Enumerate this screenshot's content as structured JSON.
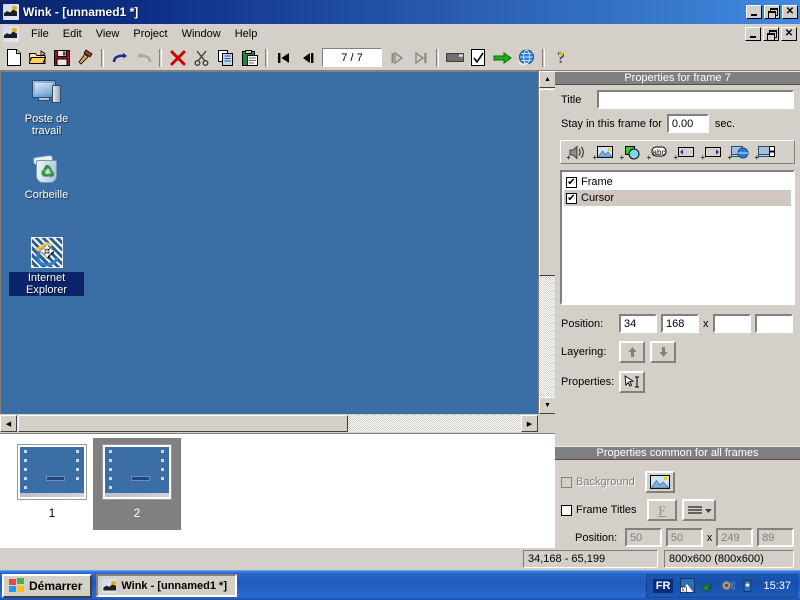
{
  "window": {
    "title": "Wink - [unnamed1 *]",
    "app_icon": "wink-bird-icon",
    "controls": {
      "minimize": "minimize-icon",
      "restore": "restore-icon",
      "close": "close-icon"
    }
  },
  "menu": {
    "items": [
      {
        "label": "File"
      },
      {
        "label": "Edit"
      },
      {
        "label": "View"
      },
      {
        "label": "Project"
      },
      {
        "label": "Window"
      },
      {
        "label": "Help"
      }
    ]
  },
  "toolbar": {
    "buttons": [
      {
        "name": "new-file-icon",
        "title": "New"
      },
      {
        "name": "open-folder-icon",
        "title": "Open"
      },
      {
        "name": "save-disk-icon",
        "title": "Save"
      },
      {
        "name": "hammer-build-icon",
        "title": "Render"
      },
      {
        "name": "undo-arrow-icon",
        "title": "Undo"
      },
      {
        "name": "redo-arrow-icon",
        "title": "Redo"
      },
      {
        "name": "delete-x-icon",
        "title": "Delete"
      },
      {
        "name": "cut-scissors-icon",
        "title": "Cut"
      },
      {
        "name": "copy-pages-icon",
        "title": "Copy"
      },
      {
        "name": "paste-clipboard-icon",
        "title": "Paste"
      },
      {
        "name": "first-frame-icon",
        "title": "First frame"
      },
      {
        "name": "previous-frame-icon",
        "title": "Previous frame"
      },
      {
        "name": "next-frame-icon",
        "title": "Next frame"
      },
      {
        "name": "last-frame-icon",
        "title": "Last frame"
      },
      {
        "name": "widescreen-icon",
        "title": "Settings"
      },
      {
        "name": "checked-page-icon",
        "title": "Project settings"
      },
      {
        "name": "green-arrow-icon",
        "title": "Render to file"
      },
      {
        "name": "browser-globe-icon",
        "title": "Preview in browser"
      },
      {
        "name": "help-question-icon",
        "title": "Help"
      }
    ],
    "frame_counter": "7 / 7"
  },
  "canvas": {
    "background_color": "#3a6ea5",
    "desktop_icons": [
      {
        "name": "my-computer",
        "label": "Poste de travail",
        "selected": false
      },
      {
        "name": "recycle-bin",
        "label": "Corbeille",
        "selected": false
      },
      {
        "name": "internet-explorer",
        "label": "Internet Explorer",
        "selected": true
      }
    ]
  },
  "filmstrip": {
    "thumbnails": [
      {
        "number": "1",
        "selected": false
      },
      {
        "number": "2",
        "selected": true
      }
    ]
  },
  "frame_properties": {
    "header": "Properties for frame 7",
    "title_label": "Title",
    "title_value": "",
    "stay_label": "Stay in this frame for",
    "stay_value": "0.00",
    "stay_unit": "sec.",
    "object_buttons": [
      {
        "name": "add-sound-icon",
        "title": "Add sound"
      },
      {
        "name": "add-image-icon",
        "title": "Add image"
      },
      {
        "name": "add-shape-icon",
        "title": "Add shape"
      },
      {
        "name": "add-text-icon",
        "title": "Add text box"
      },
      {
        "name": "add-prev-button-icon",
        "title": "Add previous button"
      },
      {
        "name": "add-next-button-icon",
        "title": "Add next button"
      },
      {
        "name": "add-url-button-icon",
        "title": "Add URL button"
      },
      {
        "name": "add-window-icon",
        "title": "Add window"
      }
    ],
    "objects": [
      {
        "label": "Frame",
        "checked": true,
        "selected": false
      },
      {
        "label": "Cursor",
        "checked": true,
        "selected": true
      }
    ],
    "position_label": "Position:",
    "position_x": "34",
    "position_y": "168",
    "position_sep": "x",
    "position_w": "",
    "position_h": "",
    "layering_label": "Layering:",
    "layer_up_icon": "arrow-up-icon",
    "layer_down_icon": "arrow-down-icon",
    "properties_label": "Properties:",
    "properties_icon": "cursor-text-properties-icon"
  },
  "common_properties": {
    "header": "Properties common for all frames",
    "background_label": "Background",
    "background_checked": false,
    "background_icon": "picture-icon",
    "frame_titles_label": "Frame Titles",
    "frame_titles_checked": false,
    "font_icon": "font-F-icon",
    "align_icon": "align-lines-icon",
    "position_label": "Position:",
    "pos_x": "50",
    "pos_y": "50",
    "pos_sep": "x",
    "pos_w": "249",
    "pos_h": "89"
  },
  "statusbar": {
    "coords": "34,168 - 65,199",
    "size": "800x600 (800x600)"
  },
  "taskbar": {
    "start_label": "Démarrer",
    "start_icon": "windows-flag-icon",
    "task_label": "Wink - [unnamed1 *]",
    "task_icon": "wink-bird-icon",
    "tray": {
      "language": "FR",
      "icons": [
        {
          "name": "screen-capture-icon"
        },
        {
          "name": "volume-speaker-green-icon"
        },
        {
          "name": "sound-wave-icon"
        },
        {
          "name": "battery-icon"
        }
      ],
      "clock": "15:37"
    }
  },
  "colors": {
    "desktop_blue": "#3a6ea5",
    "face": "#d4d0c8",
    "titlebar_dark": "#0a246a",
    "titlebar_light": "#3f8ae0",
    "panel_header": "#808080"
  }
}
